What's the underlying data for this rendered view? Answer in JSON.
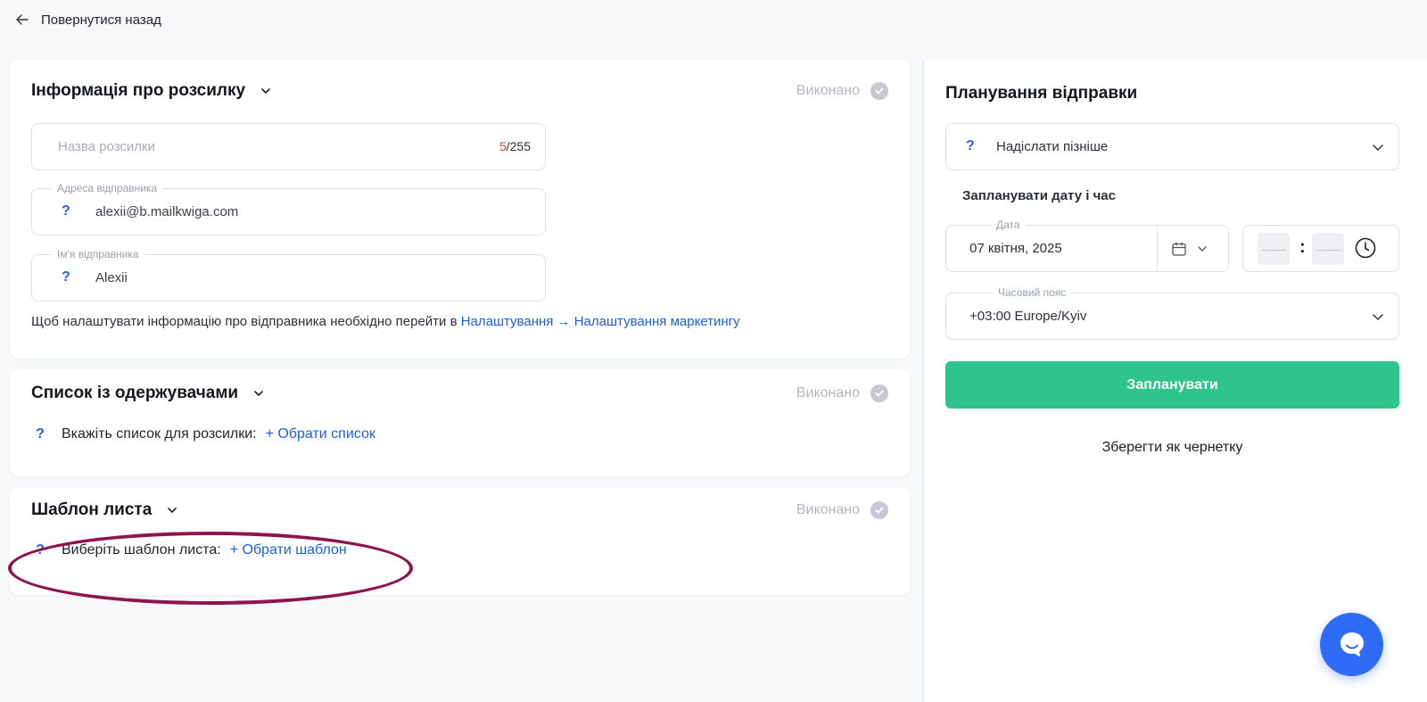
{
  "nav": {
    "back_label": "Повернутися назад"
  },
  "mailing_info": {
    "title": "Інформація про розсилку",
    "status": "Виконано",
    "name_field": {
      "placeholder": "Назва розсилки",
      "counter_current": "5",
      "counter_max": "/255"
    },
    "sender_address": {
      "label": "Адреса відправника",
      "help": "?",
      "value": "alexii@b.mailkwiga.com"
    },
    "sender_name": {
      "label": "Ім'я відправника",
      "help": "?",
      "value": "Alexii"
    },
    "hint_text": "Щоб налаштувати інформацію про відправника необхідно перейти в ",
    "hint_link": "Налаштування → Налаштування маркетингу"
  },
  "recipients": {
    "title": "Список із одержувачами",
    "status": "Виконано",
    "help": "?",
    "prompt": "Вкажіть список для розсилки:",
    "action": "+ Обрати список"
  },
  "template": {
    "title": "Шаблон листа",
    "status": "Виконано",
    "help": "?",
    "prompt": "Виберіть шаблон листа:",
    "action": "+ Обрати шаблон"
  },
  "schedule": {
    "title": "Планування відправки",
    "send_mode": {
      "help": "?",
      "value": "Надіслати пізніше"
    },
    "subtitle": "Запланувати дату і час",
    "date": {
      "label": "Дата",
      "value": "07 квітня, 2025"
    },
    "time": {
      "hours": "——",
      "separator": ":",
      "minutes": "——"
    },
    "timezone": {
      "label": "Часовий пояс",
      "value": "+03:00 Europe/Kyiv"
    },
    "submit_label": "Запланувати",
    "draft_label": "Зберегти як чернетку"
  },
  "colors": {
    "accent": "#30c48d",
    "link": "#1d5fe0",
    "highlight": "#8d1450",
    "chat": "#2f6cf6"
  },
  "icons": [
    "arrow-left-icon",
    "chevron-down-icon",
    "check-circle-icon",
    "calendar-icon",
    "clock-icon",
    "chat-icon"
  ]
}
